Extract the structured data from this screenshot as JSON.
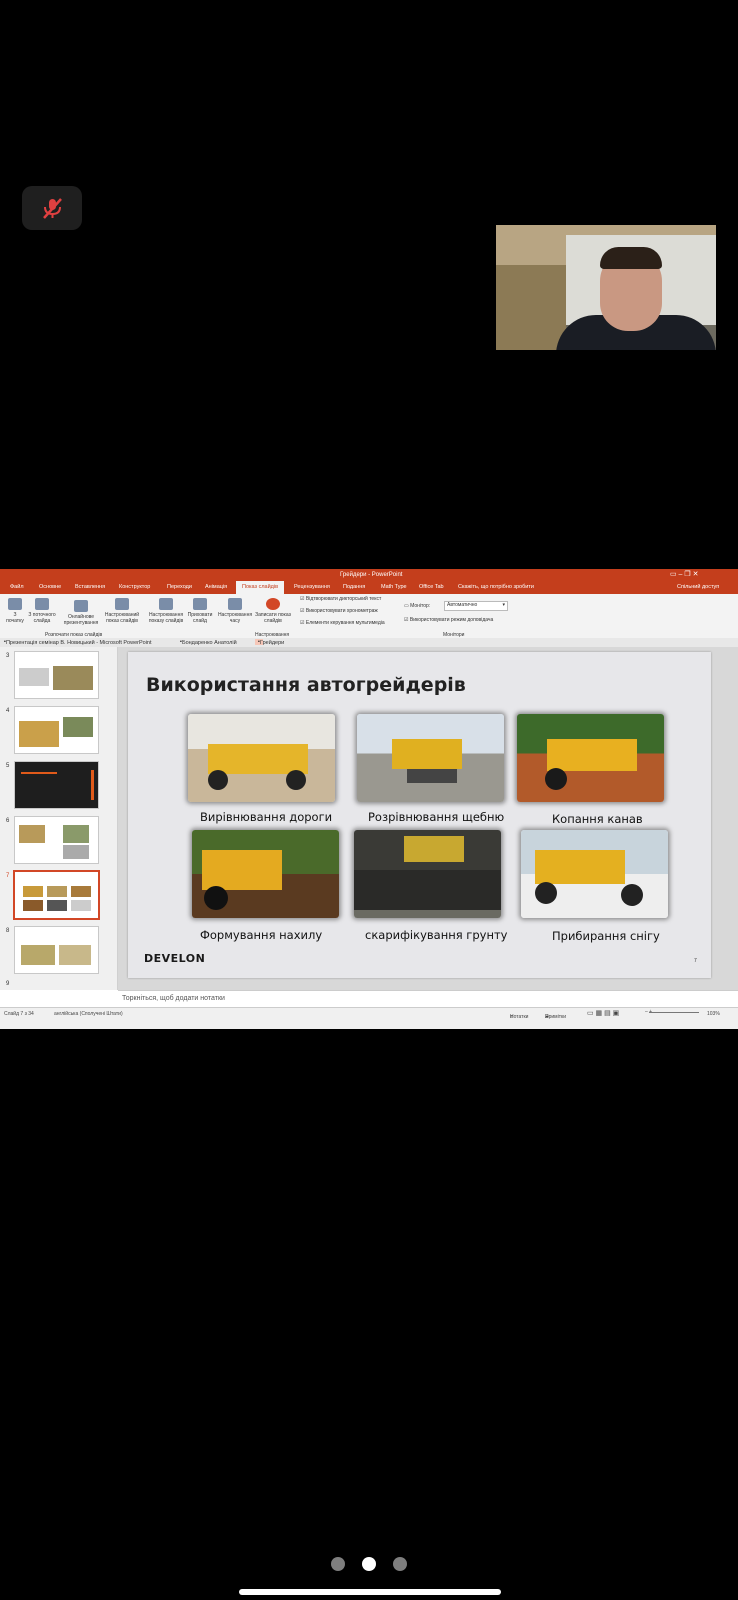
{
  "call": {
    "mute_icon": "mic-off-icon",
    "accent": "#e04040"
  },
  "app": {
    "title": "Грейдери - PowerPoint",
    "menu": [
      "Файл",
      "Основне",
      "Вставлення",
      "Конструктор",
      "Переходи",
      "Анімація",
      "Показ слайдів",
      "Рецензування",
      "Подання",
      "Math Type",
      "Office Tab"
    ],
    "tell_me": "Скажіть, що потрібно зробити",
    "share": "Спільний доступ",
    "ribbon": {
      "b1": "З початку",
      "b2": "З поточного слайда",
      "b3": "Онлайнове презентування",
      "b4": "Настроюваний показ слайдів",
      "group1": "Розпочати показ слайдів",
      "b5": "Настроювання показу слайдів",
      "b6": "Приховати слайд",
      "b7": "Настроювання часу",
      "b8": "Записати показ слайдів",
      "cb1": "Відтворювати дикторський текст",
      "cb2": "Використовувати хронометраж",
      "cb3": "Елементи керування мультимедіа",
      "group2": "Настроювання",
      "monitor_label": "Монітор:",
      "monitor_value": "Автоматично",
      "cb4": "Використовувати режим доповідача",
      "group3": "Монітори"
    },
    "tabs": [
      "Презентація семінар В. Новицький - Microsoft PowerPoint",
      "Бондаренко Анатолій",
      "Грейдери"
    ],
    "slide_nums": [
      "3",
      "4",
      "5",
      "6",
      "7",
      "8",
      "9"
    ],
    "notes": "Торкніться, щоб додати нотатки",
    "status": {
      "slide": "Слайд 7 з 34",
      "lang": "англійська (Сполучені Штати)",
      "notes_btn": "Нотатки",
      "comments_btn": "Примітки",
      "zoom": "103%"
    }
  },
  "slide": {
    "title": "Використання автогрейдерів",
    "captions": [
      "Вирівнювання дороги",
      "Розрівнювання щебню",
      "Копання канав",
      "Формування нахилу",
      "скарифікування грунту",
      "Прибирання снігу"
    ],
    "logo": "DEVELON",
    "page": "7"
  }
}
